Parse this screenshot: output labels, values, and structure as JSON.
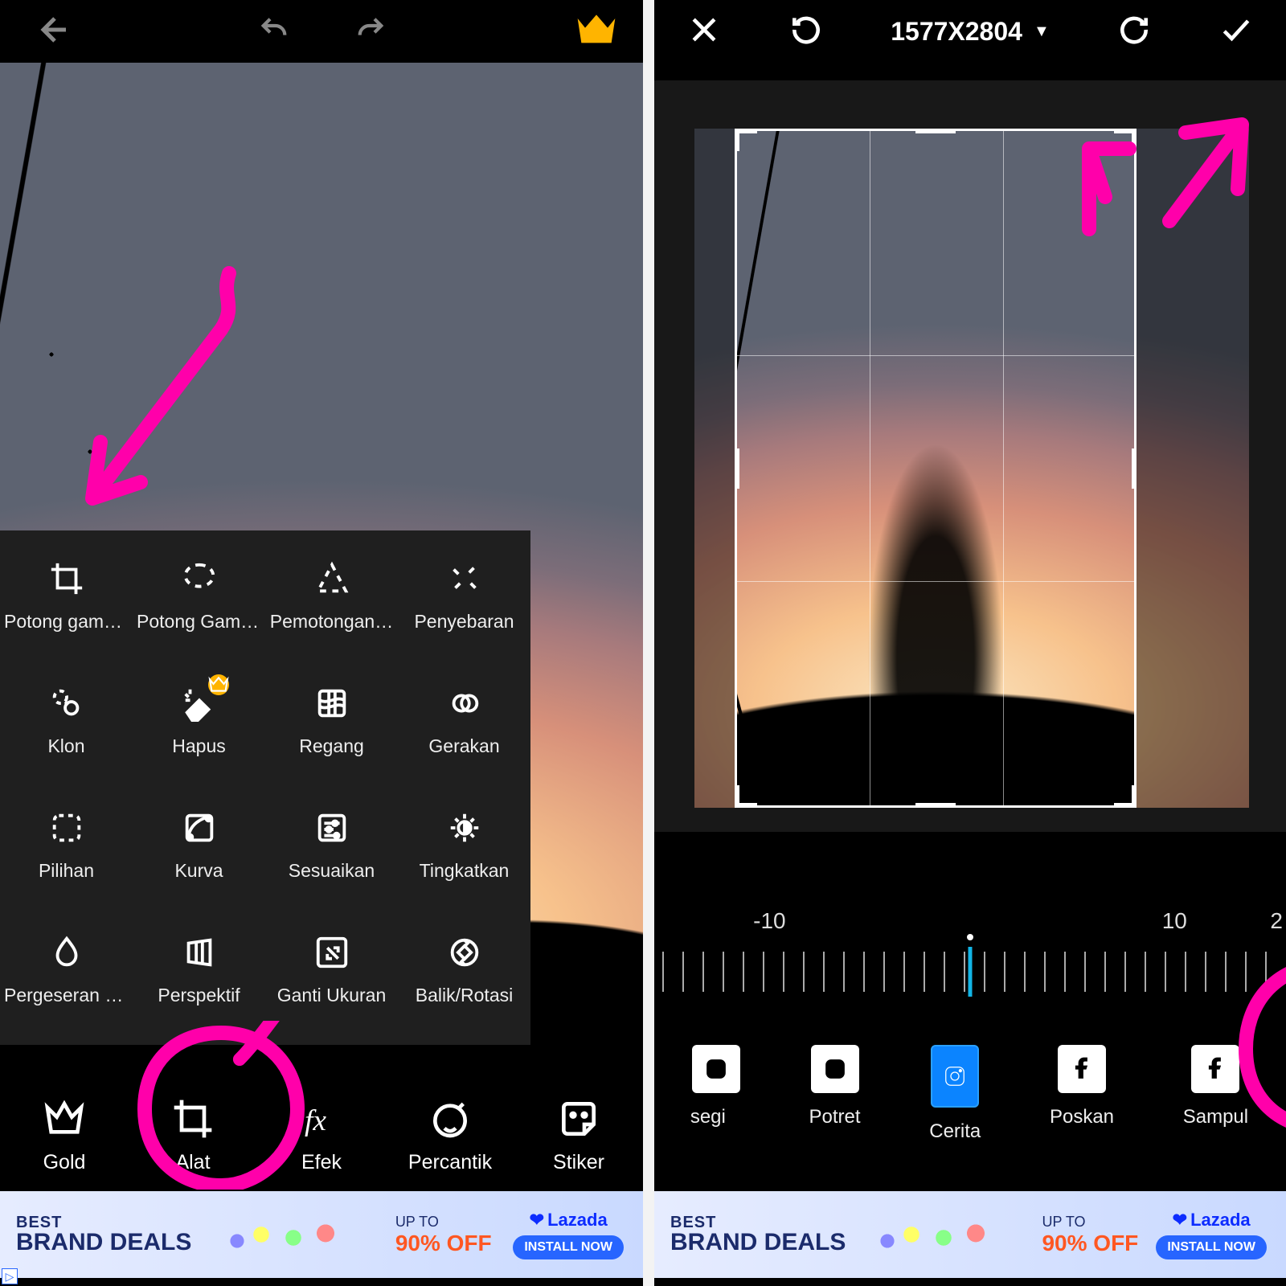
{
  "left": {
    "tools": [
      {
        "id": "crop",
        "label": "Potong gambar"
      },
      {
        "id": "shapecrop",
        "label": "Potong Gamb…"
      },
      {
        "id": "cutout",
        "label": "Pemotongan…"
      },
      {
        "id": "dispersion",
        "label": "Penyebaran"
      },
      {
        "id": "clone",
        "label": "Klon"
      },
      {
        "id": "remove",
        "label": "Hapus",
        "premium": true
      },
      {
        "id": "stretch",
        "label": "Regang"
      },
      {
        "id": "motion",
        "label": "Gerakan"
      },
      {
        "id": "selection",
        "label": "Pilihan"
      },
      {
        "id": "curves",
        "label": "Kurva"
      },
      {
        "id": "adjust",
        "label": "Sesuaikan"
      },
      {
        "id": "enhance",
        "label": "Tingkatkan"
      },
      {
        "id": "hue",
        "label": "Pergeseran M…"
      },
      {
        "id": "perspective",
        "label": "Perspektif"
      },
      {
        "id": "resize",
        "label": "Ganti Ukuran"
      },
      {
        "id": "fliprotate",
        "label": "Balik/Rotasi"
      }
    ],
    "bottombar": [
      {
        "id": "gold",
        "label": "Gold"
      },
      {
        "id": "alat",
        "label": "Alat"
      },
      {
        "id": "efek",
        "label": "Efek"
      },
      {
        "id": "percantik",
        "label": "Percantik"
      },
      {
        "id": "stiker",
        "label": "Stiker"
      }
    ]
  },
  "right": {
    "dimensions": "1577X2804",
    "ruler": {
      "left": "-10",
      "right": "10",
      "far_right": "2"
    },
    "ratios": [
      {
        "id": "segi",
        "label": "segi",
        "net": "ig"
      },
      {
        "id": "potret",
        "label": "Potret",
        "net": "ig"
      },
      {
        "id": "cerita",
        "label": "Cerita",
        "net": "ig",
        "selected": true
      },
      {
        "id": "poskan",
        "label": "Poskan",
        "net": "fb"
      },
      {
        "id": "sampul",
        "label": "Sampul",
        "net": "fb"
      }
    ]
  },
  "ad": {
    "line1": "BEST",
    "line2": "BRAND DEALS",
    "upto": "UP TO",
    "off": "90% OFF",
    "brand": "Lazada",
    "cta": "INSTALL NOW"
  }
}
